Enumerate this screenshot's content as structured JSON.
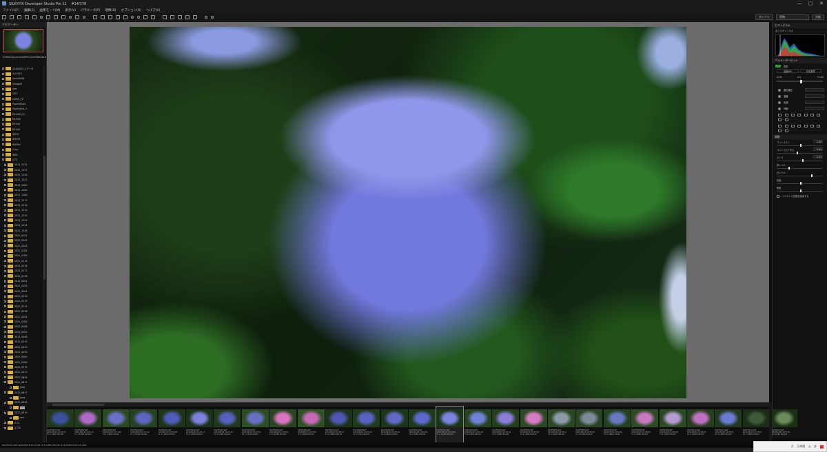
{
  "app": {
    "title": "SILKYPIX Developer Studio Pro 11 　#14/178",
    "menu": [
      "ファイル(F)",
      "編集(E)",
      "画像モード(M)",
      "表示(V)",
      "パラメータ(P)",
      "現像(D)",
      "オプション(O)",
      "ヘルプ(H)"
    ],
    "window_controls": [
      "—",
      "▢",
      "✕"
    ]
  },
  "toolbar": {
    "right_chips": [
      "セレクト",
      "原稿",
      "対象"
    ]
  },
  "left_panel": {
    "navigator_title": "ナビゲーター",
    "path": "D:¥MyDocuments¥Pictures¥NEXDraw¥",
    "folders": [
      {
        "name": "20180821_1データ",
        "expanded": true
      },
      {
        "name": "4-21010",
        "expanded": false
      },
      {
        "name": "Gomi2008",
        "expanded": false
      },
      {
        "name": "Gmagolf",
        "expanded": false
      },
      {
        "name": "Iww",
        "expanded": false
      },
      {
        "name": "CEJT",
        "expanded": false
      },
      {
        "name": "LUMIX_FZ",
        "expanded": false
      },
      {
        "name": "PowerShot2",
        "expanded": false
      },
      {
        "name": "PowerShot_5",
        "expanded": true
      },
      {
        "name": "RX10M_CS",
        "expanded": false
      },
      {
        "name": "RX10M",
        "expanded": false
      },
      {
        "name": "RX100",
        "expanded": false
      },
      {
        "name": "RX100",
        "expanded": false
      },
      {
        "name": "W555",
        "expanded": false
      },
      {
        "name": "W3501",
        "expanded": false
      },
      {
        "name": "W3050",
        "expanded": false
      },
      {
        "name": "1 ext",
        "expanded": false
      },
      {
        "name": "WEB",
        "expanded": false
      },
      {
        "name": "X-T3",
        "expanded": true
      },
      {
        "name": "2021_1125",
        "expanded": false
      },
      {
        "name": "2021_1127",
        "expanded": false
      },
      {
        "name": "2021_1130",
        "expanded": false
      },
      {
        "name": "2021_1201",
        "expanded": false
      },
      {
        "name": "2021_1202",
        "expanded": false
      },
      {
        "name": "2021_1205",
        "expanded": false
      },
      {
        "name": "2021_1208",
        "expanded": false
      },
      {
        "name": "2021_1211",
        "expanded": false
      },
      {
        "name": "2021_1214",
        "expanded": false
      },
      {
        "name": "2021_1215",
        "expanded": false
      },
      {
        "name": "2021_1220",
        "expanded": false
      },
      {
        "name": "2021_1222",
        "expanded": false
      },
      {
        "name": "2021_1224",
        "expanded": false
      },
      {
        "name": "2021_1226",
        "expanded": false
      },
      {
        "name": "2022_0101",
        "expanded": false
      },
      {
        "name": "2022_0102",
        "expanded": false
      },
      {
        "name": "2022_0103",
        "expanded": false
      },
      {
        "name": "2022_0106",
        "expanded": false
      },
      {
        "name": "2022_0108",
        "expanded": false
      },
      {
        "name": "2022_0115",
        "expanded": false
      },
      {
        "name": "2022_0116",
        "expanded": false
      },
      {
        "name": "2022_0117",
        "expanded": false
      },
      {
        "name": "2022_0118",
        "expanded": false
      },
      {
        "name": "2022_0201",
        "expanded": false
      },
      {
        "name": "2022_0203",
        "expanded": false
      },
      {
        "name": "2022_0204",
        "expanded": false
      },
      {
        "name": "2022_0210",
        "expanded": false
      },
      {
        "name": "2022_0219",
        "expanded": false
      },
      {
        "name": "2022_0224",
        "expanded": false
      },
      {
        "name": "2022_0226",
        "expanded": false
      },
      {
        "name": "2022_0305",
        "expanded": false
      },
      {
        "name": "2022_0306",
        "expanded": false
      },
      {
        "name": "2022_0308",
        "expanded": false
      },
      {
        "name": "2022_0404",
        "expanded": false
      },
      {
        "name": "2022_0406",
        "expanded": false
      },
      {
        "name": "2022_0410",
        "expanded": false
      },
      {
        "name": "2022_0423",
        "expanded": false
      },
      {
        "name": "2022_0430",
        "expanded": false
      },
      {
        "name": "2022_0505",
        "expanded": false
      },
      {
        "name": "2022_0508",
        "expanded": false
      },
      {
        "name": "2022_0515",
        "expanded": false
      },
      {
        "name": "2022_0527",
        "expanded": false
      },
      {
        "name": "2022_0604",
        "expanded": false
      },
      {
        "name": "2022_0611",
        "expanded": true
      },
      {
        "name": "jpeg",
        "expanded": false
      },
      {
        "name": "2022_0617",
        "expanded": true
      },
      {
        "name": "jpeg",
        "expanded": false
      },
      {
        "name": "2022_0618",
        "expanded": true
      },
      {
        "name": "jpeg",
        "expanded": false,
        "selected": true
      },
      {
        "name": "2022_0619",
        "expanded": true
      },
      {
        "name": "raw",
        "expanded": false
      },
      {
        "name": "X-T2",
        "expanded": false
      },
      {
        "name": "X-T30",
        "expanded": false
      }
    ]
  },
  "right_panel": {
    "histogram_title": "ヒストグラム",
    "histogram_sub": "全てのチャンネル",
    "taste_title": "パラメーターセット",
    "taste_value": "標準",
    "wb_buttons": [
      "自動WB",
      "白色基準"
    ],
    "exposure": {
      "left": "-0.00",
      "mid": "0.0",
      "right": "+0.00"
    },
    "tools": [
      {
        "name": "露出補正",
        "has_dd": true
      },
      {
        "name": "濃度",
        "has_dd": true
      },
      {
        "name": "色調",
        "has_dd": true
      },
      {
        "name": "詳細",
        "has_dd": true
      }
    ],
    "adjust_title": "調整",
    "adjust": [
      {
        "name": "コントラスト",
        "value": "1.00",
        "level": 0.5
      },
      {
        "name": "コントラスト中心",
        "value": "0.44",
        "level": 0.44
      },
      {
        "name": "ガンマ",
        "value": "2.15",
        "level": 0.55
      },
      {
        "name": "黒レベル",
        "value": "",
        "level": 0.25
      },
      {
        "name": "白レベル",
        "value": "",
        "level": 0.75
      },
      {
        "name": "彩度",
        "value": "",
        "level": 0.5
      },
      {
        "name": "明度",
        "value": "",
        "level": 0.5
      }
    ],
    "checkbox_label": "ハイライト回復を使用する"
  },
  "filmstrip": {
    "items": [
      {
        "name": "DSCF6287.RAF",
        "date": "2022/06/18 12:01:07",
        "exif": "F1.4 1/680 ISO125",
        "c1": "#3b4f9a",
        "c2": "#1f3a1a"
      },
      {
        "name": "DSCF6288.RAF",
        "date": "2022/06/18 12:01:15",
        "exif": "F1.4 1/680 ISO125",
        "c1": "#b069c8",
        "c2": "#233c1e"
      },
      {
        "name": "DSCF6289.RAF",
        "date": "2022/06/18 12:01:23",
        "exif": "F1.4 1/640 ISO125",
        "c1": "#6c6fc8",
        "c2": "#2a4a20"
      },
      {
        "name": "DSCF6290.RAF",
        "date": "2022/06/18 12:01:30",
        "exif": "F1.4 1/500 ISO125",
        "c1": "#5c66c0",
        "c2": "#264220"
      },
      {
        "name": "DSCF6291.RAF",
        "date": "2022/06/18 12:02:08",
        "exif": "F1.4 1/680 ISO125",
        "c1": "#4e5bb8",
        "c2": "#1f3519"
      },
      {
        "name": "DSCF6292.RAF",
        "date": "2022/06/18 12:02:17",
        "exif": "F1.4 1/680 ISO125",
        "c1": "#7e80de",
        "c2": "#1b3216"
      },
      {
        "name": "DSCF6293.RAF",
        "date": "2022/06/18 12:02:24",
        "exif": "F1.4 1/480 ISO125",
        "c1": "#5660bc",
        "c2": "#20391b"
      },
      {
        "name": "DSCF6294.RAF",
        "date": "2022/06/18 12:02:31",
        "exif": "F1.4 1/500 ISO125",
        "c1": "#6870c6",
        "c2": "#2c4d22"
      },
      {
        "name": "DSCF6295.RAF",
        "date": "2022/06/18 12:03:02",
        "exif": "F1.4 1/680 ISO125",
        "c1": "#d874c0",
        "c2": "#2a4620"
      },
      {
        "name": "DSCF6296.RAF",
        "date": "2022/06/18 12:03:09",
        "exif": "F1.4 1/680 ISO125",
        "c1": "#c66ab8",
        "c2": "#2f5224"
      },
      {
        "name": "DSCF6297.RAF",
        "date": "2022/06/18 12:03:17",
        "exif": "F1.4 1/680 ISO125",
        "c1": "#4d56b0",
        "c2": "#1c3317"
      },
      {
        "name": "DSCF6298.RAF",
        "date": "2022/06/18 12:03:25",
        "exif": "F1.4 1/640 ISO125",
        "c1": "#5862c2",
        "c2": "#203a1c"
      },
      {
        "name": "DSCF6299.RAF",
        "date": "2022/06/18 12:03:40",
        "exif": "F1.4 1/680 ISO125",
        "c1": "#6068c8",
        "c2": "#1d3518"
      },
      {
        "name": "DSCF6300.RAF",
        "date": "2022/06/18 12:04:01",
        "exif": "F1.4 1/680 ISO125",
        "c1": "#5c68cc",
        "c2": "#1e3a1a"
      },
      {
        "name": "DSCF6301.RAF",
        "date": "2022/06/18 12:04:08",
        "exif": "F1.4 1/680 ISO125",
        "c1": "#7a84e0",
        "c2": "#1c3517",
        "current": true
      },
      {
        "name": "DSCF6302.RAF",
        "date": "2022/06/18 12:04:22",
        "exif": "F1.4 1/680 ISO125",
        "c1": "#6e82d8",
        "c2": "#24431e"
      },
      {
        "name": "DSCF6303.RAF",
        "date": "2022/06/18 12:04:41",
        "exif": "F1.4 1/680 ISO125",
        "c1": "#8a7cd8",
        "c2": "#22401c"
      },
      {
        "name": "DSCF6304.RAF",
        "date": "2022/06/18 12:05:00",
        "exif": "F1.4 1/680 ISO125",
        "c1": "#d67cc4",
        "c2": "#2c4a22"
      },
      {
        "name": "DSCF6305.RAF",
        "date": "2022/06/18 12:05:12",
        "exif": "F1.4 1/640 ISO125",
        "c1": "#8c9aa8",
        "c2": "#2a4622"
      },
      {
        "name": "DSCF6306.RAF",
        "date": "2022/06/18 12:05:30",
        "exif": "F1.4 1/680 ISO125",
        "c1": "#7c8a9c",
        "c2": "#284420"
      },
      {
        "name": "DSCF6307.RAF",
        "date": "2022/06/18 12:05:44",
        "exif": "F1.4 1/680 ISO125",
        "c1": "#6878c0",
        "c2": "#254220"
      },
      {
        "name": "DSCF6308.RAF",
        "date": "2022/06/18 12:06:02",
        "exif": "F1.4 1/680 ISO125",
        "c1": "#c878c0",
        "c2": "#2e4c24"
      },
      {
        "name": "DSCF6309.RAF",
        "date": "2022/06/18 12:06:19",
        "exif": "F1.4 1/680 ISO125",
        "c1": "#b49ad0",
        "c2": "#2a4a22"
      },
      {
        "name": "DSCF6310.RAF",
        "date": "2022/06/18 12:06:33",
        "exif": "F1.4 1/680 ISO125",
        "c1": "#c070c4",
        "c2": "#263e1e"
      },
      {
        "name": "DSCF6311.RAF",
        "date": "2022/06/18 12:06:51",
        "exif": "F1.4 1/680 ISO125",
        "c1": "#6a7ad0",
        "c2": "#20381c"
      },
      {
        "name": "DSCF6312.RAF",
        "date": "2022/06/18 12:07:10",
        "exif": "F1.4 1/680 ISO125",
        "c1": "#3e5a3a",
        "c2": "#1a2d16"
      },
      {
        "name": "DSCF6313.RAF",
        "date": "2022/06/18 12:07:28",
        "exif": "F1.4 1/680 ISO125",
        "c1": "#6a8a5a",
        "c2": "#1c3016"
      }
    ]
  },
  "status": {
    "text": "DSCF6301.RAF 2022/06/18 12:04:08 F1.4 1/680 ISO125 X-T3 XF56mmF1.2 R APD"
  },
  "corner_box": {
    "items": [
      "ぷ",
      "日本語",
      "A",
      "あ"
    ]
  }
}
